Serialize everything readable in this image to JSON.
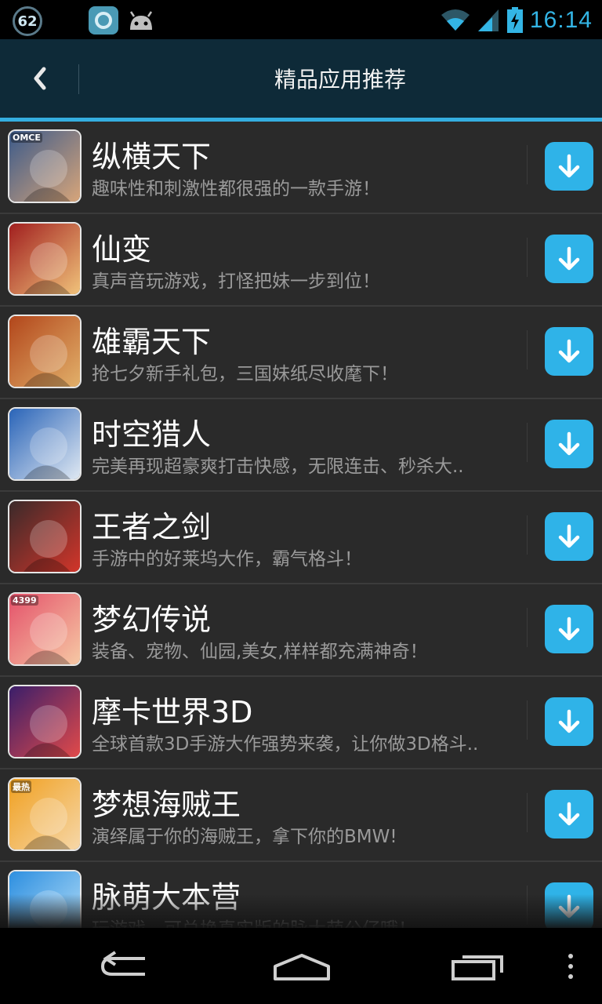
{
  "status_bar": {
    "notification_count": "62",
    "time": "16:14",
    "icons": [
      "chat-app-icon",
      "android-icon",
      "wifi-icon",
      "signal-icon",
      "battery-charging-icon"
    ]
  },
  "header": {
    "title": "精品应用推荐",
    "back_icon": "chevron-left-icon"
  },
  "apps": [
    {
      "name": "纵横天下",
      "desc": "趣味性和刺激性都很强的一款手游！",
      "icon_badge": "OMCE",
      "color_a": "#3b5a8a",
      "color_b": "#d7a57a"
    },
    {
      "name": "仙变",
      "desc": "真声音玩游戏，打怪把妹一步到位！",
      "icon_badge": "",
      "color_a": "#a11f1f",
      "color_b": "#f0c27a"
    },
    {
      "name": "雄霸天下",
      "desc": "抢七夕新手礼包，三国妹纸尽收麾下！",
      "icon_badge": "",
      "color_a": "#b2461b",
      "color_b": "#e2b06a"
    },
    {
      "name": "时空猎人",
      "desc": "完美再现超豪爽打击快感，无限连击、秒杀大..",
      "icon_badge": "",
      "color_a": "#2a64b8",
      "color_b": "#dfe8f2"
    },
    {
      "name": "王者之剑",
      "desc": "手游中的好莱坞大作，霸气格斗！",
      "icon_badge": "",
      "color_a": "#3a2a2a",
      "color_b": "#d2352a"
    },
    {
      "name": "梦幻传说",
      "desc": "装备、宠物、仙园,美女,样样都充满神奇！",
      "icon_badge": "4399",
      "color_a": "#e4516a",
      "color_b": "#f6c8a4"
    },
    {
      "name": "摩卡世界3D",
      "desc": "全球首款3D手游大作强势来袭，让你做3D格斗..",
      "icon_badge": "",
      "color_a": "#3a1e6a",
      "color_b": "#e14a4a"
    },
    {
      "name": "梦想海贼王",
      "desc": "演绎属于你的海贼王，拿下你的BMW!",
      "icon_badge": "最热",
      "color_a": "#f0a020",
      "color_b": "#f6d7a8"
    },
    {
      "name": "脉萌大本营",
      "desc": "玩游戏，可兑换真实版的脉大萌公仔哦！",
      "icon_badge": "",
      "color_a": "#2d8fe0",
      "color_b": "#b8e0f8"
    }
  ],
  "download_icon": "download-arrow-icon",
  "nav_bar": {
    "icons": [
      "back-nav-icon",
      "home-nav-icon",
      "recent-apps-icon",
      "overflow-menu-icon"
    ]
  },
  "colors": {
    "accent": "#33b5e5",
    "title_bar": "#0e2a38",
    "list_bg": "#2a2a2a",
    "download_button": "#2fb3e8"
  }
}
